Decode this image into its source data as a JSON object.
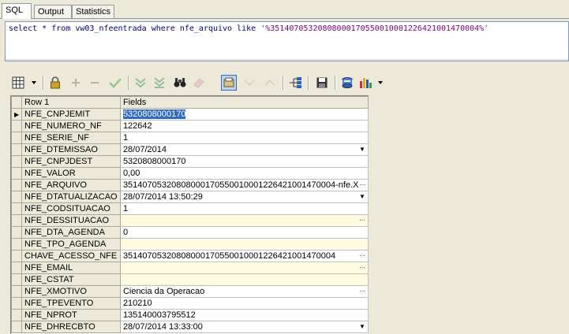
{
  "tabs": [
    {
      "label": "SQL",
      "active": true
    },
    {
      "label": "Output",
      "active": false
    },
    {
      "label": "Statistics",
      "active": false
    }
  ],
  "editor": {
    "keyword_select": "select",
    "star": "*",
    "keyword_from": "from",
    "table": "vw03_nfeentrada",
    "keyword_where": "where",
    "column": "nfe_arquivo",
    "keyword_like": "like",
    "literal": "'%35140705320808000170550010001226421001470004%'"
  },
  "toolbar": {
    "icons": [
      "grid-options-icon",
      "lock-icon",
      "insert-icon",
      "delete-icon",
      "post-icon",
      "first-record-icon",
      "last-record-icon",
      "find-icon",
      "eraser-icon",
      "single-record-view-icon",
      "prev-icon",
      "next-icon",
      "tree-icon",
      "save-icon",
      "export-icon",
      "chart-icon"
    ]
  },
  "grid": {
    "header": {
      "col1": "Row 1",
      "col2": "Fields"
    },
    "rows": [
      {
        "name": "NFE_CNPJEMIT",
        "value": "5320808000170",
        "button": "",
        "yellow": false,
        "selected": true
      },
      {
        "name": "NFE_NUMERO_NF",
        "value": "122642",
        "button": "",
        "yellow": false
      },
      {
        "name": "NFE_SERIE_NF",
        "value": "1",
        "button": "",
        "yellow": false
      },
      {
        "name": "NFE_DTEMISSAO",
        "value": "28/07/2014",
        "button": "▼",
        "yellow": false
      },
      {
        "name": "NFE_CNPJDEST",
        "value": "5320808000170",
        "button": "",
        "yellow": false
      },
      {
        "name": "NFE_VALOR",
        "value": "0,00",
        "button": "",
        "yellow": false
      },
      {
        "name": "NFE_ARQUIVO",
        "value": "35140705320808000170550010001226421001470004-nfe.XML",
        "button": "···",
        "yellow": false
      },
      {
        "name": "NFE_DTATUALIZACAO",
        "value": "28/07/2014 13:50:29",
        "button": "▼",
        "yellow": false
      },
      {
        "name": "NFE_CODSITUACAO",
        "value": "1",
        "button": "",
        "yellow": false
      },
      {
        "name": "NFE_DESSITUACAO",
        "value": "",
        "button": "···",
        "yellow": true
      },
      {
        "name": "NFE_DTA_AGENDA",
        "value": "0",
        "button": "",
        "yellow": false
      },
      {
        "name": "NFE_TPO_AGENDA",
        "value": "",
        "button": "",
        "yellow": true
      },
      {
        "name": "CHAVE_ACESSO_NFE",
        "value": "35140705320808000170550010001226421001470004",
        "button": "···",
        "yellow": false
      },
      {
        "name": "NFE_EMAIL",
        "value": "",
        "button": "···",
        "yellow": true
      },
      {
        "name": "NFE_CSTAT",
        "value": "",
        "button": "",
        "yellow": true
      },
      {
        "name": "NFE_XMOTIVO",
        "value": "Ciencia da Operacao",
        "button": "···",
        "yellow": false
      },
      {
        "name": "NFE_TPEVENTO",
        "value": "210210",
        "button": "",
        "yellow": false
      },
      {
        "name": "NFE_NPROT",
        "value": "135140003795512",
        "button": "",
        "yellow": false
      },
      {
        "name": "NFE_DHRECBTO",
        "value": "28/07/2014 13:33:00",
        "button": "▼",
        "yellow": false
      }
    ]
  },
  "colors": {
    "selection": "#316ac5",
    "editor_keyword": "#00007f",
    "editor_string": "#7f007f",
    "null_field": "#fffbe0"
  }
}
